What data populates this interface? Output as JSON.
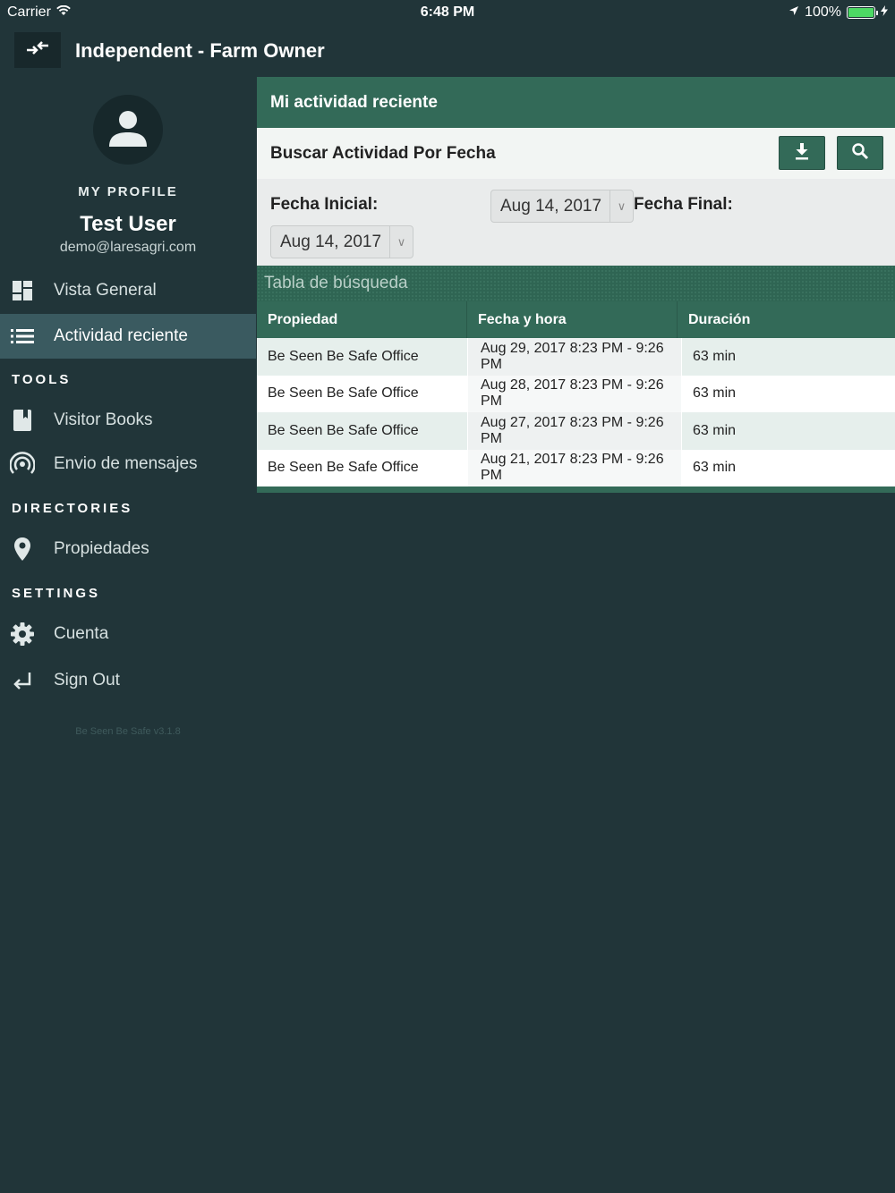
{
  "status_bar": {
    "carrier": "Carrier",
    "time": "6:48 PM",
    "battery_pct": "100%"
  },
  "header": {
    "title": "Independent - Farm Owner"
  },
  "profile": {
    "label": "MY PROFILE",
    "name": "Test User",
    "email": "demo@laresagri.com"
  },
  "nav": {
    "vista_general": "Vista General",
    "actividad_reciente": "Actividad reciente",
    "tools_label": "TOOLS",
    "visitor_books": "Visitor Books",
    "envio_mensajes": "Envio de mensajes",
    "directories_label": "DIRECTORIES",
    "propiedades": "Propiedades",
    "settings_label": "SETTINGS",
    "cuenta": "Cuenta",
    "sign_out": "Sign Out",
    "version": "Be Seen Be Safe v3.1.8"
  },
  "panel": {
    "title": "Mi actividad reciente",
    "search_label": "Buscar Actividad Por Fecha",
    "fecha_inicial_label": "Fecha Inicial:",
    "fecha_inicial_value": "Aug 14, 2017",
    "fecha_final_label": "Fecha Final:",
    "fecha_final_value": "Aug 14, 2017",
    "table_title": "Tabla de búsqueda"
  },
  "table": {
    "headers": [
      "Propiedad",
      "Fecha y hora",
      "Duración"
    ],
    "rows": [
      [
        "Be Seen Be Safe Office",
        "Aug 29, 2017 8:23 PM - 9:26 PM",
        "63 min"
      ],
      [
        "Be Seen Be Safe Office",
        "Aug 28, 2017 8:23 PM - 9:26 PM",
        "63 min"
      ],
      [
        "Be Seen Be Safe Office",
        "Aug 27, 2017 8:23 PM - 9:26 PM",
        "63 min"
      ],
      [
        "Be Seen Be Safe Office",
        "Aug 21, 2017 8:23 PM - 9:26 PM",
        "63 min"
      ]
    ]
  },
  "colors": {
    "background": "#213539",
    "accent_green": "#336a58",
    "active_nav": "#3a5a60",
    "battery": "#4cd964"
  }
}
